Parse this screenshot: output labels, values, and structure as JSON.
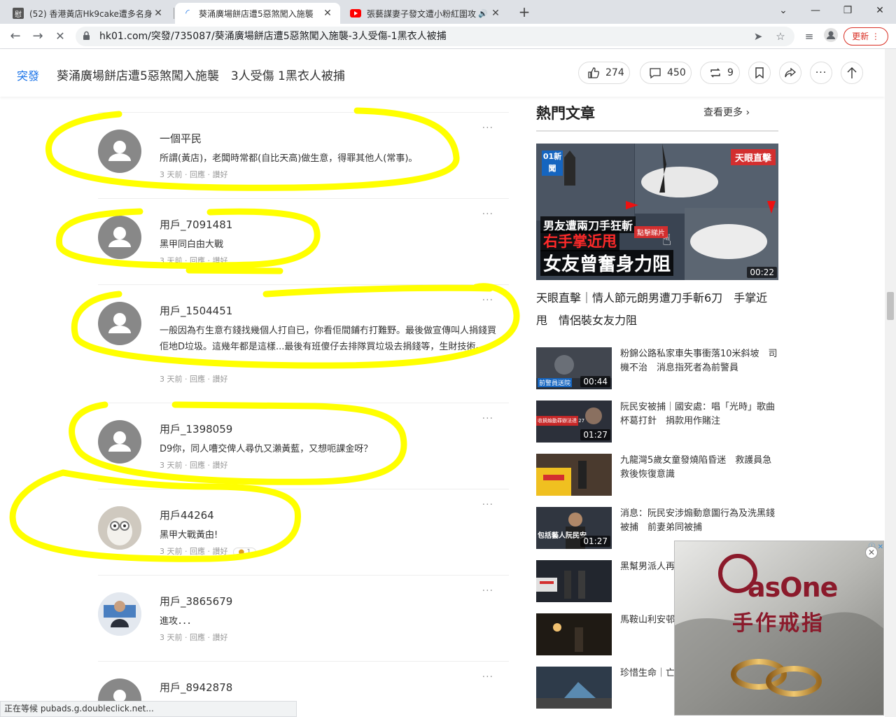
{
  "browser": {
    "tabs": [
      {
        "favicon": "hk9cake-favicon",
        "title": "(52) 香港黃店Hk9cake遭多名身份",
        "active": false
      },
      {
        "favicon": "hk01-favicon",
        "title": "葵涌廣場餅店遭5惡煞闖入施襲",
        "active": true
      },
      {
        "favicon": "youtube-favicon",
        "title": "張藝謀妻子發文遭小粉紅圍攻",
        "active": false
      }
    ],
    "url": "hk01.com/突發/735087/葵涌廣場餅店遭5惡煞闖入施襲-3人受傷-1黑衣人被捕",
    "update_label": "更新",
    "status_text": "正在等候 pubads.g.doubleclick.net..."
  },
  "header": {
    "section": "突發",
    "headline": "葵涌廣場餅店遭5惡煞闖入施襲　3人受傷 1黑衣人被捕",
    "likes": "274",
    "comments": "450",
    "shares": "9"
  },
  "comments": [
    {
      "name": "一個平民",
      "text": "所謂(黃店)，老闆時常都(自比天高)做生意，得罪其他人(常事)。",
      "meta": "3 天前 · 回應 · 讚好",
      "avatar": "default"
    },
    {
      "name": "用戶_7091481",
      "text": "黑甲同白甶大戰",
      "meta": "3 天前 · 回應 · 讚好",
      "avatar": "default"
    },
    {
      "name": "用戶_1504451",
      "text": "一般因為冇生意冇錢找幾個人打自已，你看佢間鋪冇打難野。最後做宣傳叫人捐錢買佢地D垃圾。這幾年都是這樣...最後有班傻仔去排隊買垃圾去捐錢等，生財技術。",
      "meta": "3 天前 · 回應 · 讚好",
      "avatar": "default"
    },
    {
      "name": "用戶_1398059",
      "text": "D9你，同人嘈交俾人尋仇又瀨黃藍，又想呃課金呀？",
      "meta": "3 天前 · 回應 · 讚好",
      "avatar": "default"
    },
    {
      "name": "用戶44264",
      "text": "黑甲大戰黃甶!",
      "meta": "3 天前 · 回應 · 讚好",
      "avatar": "owl",
      "reaction": "1"
    },
    {
      "name": "用戶_3865679",
      "text": "進攻．．．",
      "meta": "3 天前 · 回應 · 讚好",
      "avatar": "photo"
    },
    {
      "name": "用戶_8942878",
      "text": "",
      "meta": "",
      "avatar": "default"
    }
  ],
  "sidebar": {
    "title": "熱門文章",
    "see_more": "查看更多",
    "feature": {
      "badge": "天眼直擊",
      "logo": "01新聞",
      "caption1": "男友遭兩刀手狂斬",
      "caption2": "右手掌近甩",
      "caption3": "女友曾奮身力阻",
      "click_label": "點擊睇片",
      "duration": "00:22",
      "title": "天眼直擊｜情人節元朗男遭刀手斬6刀　手掌近甩　情侶裝女友力阻"
    },
    "items": [
      {
        "text": "粉錦公路私家車失事衝落10米斜坡　司機不治　消息指死者為前警員",
        "duration": "00:44",
        "thumb_color": "#3a3f48",
        "thumb_caption": "前警員送院"
      },
      {
        "text": "阮民安被捕｜國安處：唱「光時」歌曲　杯葛打針　捐款用作賭注",
        "duration": "01:27",
        "thumb_color": "#2a2e38",
        "thumb_caption": "收摘煽動罪辦法達 27"
      },
      {
        "text": "九龍灣5歲女童發燒陷昏迷　救護員急救後恢復意識",
        "duration": "",
        "thumb_color": "#5a4030",
        "thumb_caption": ""
      },
      {
        "text": "消息：阮民安涉煽動意圖行為及洗黑錢被捕　前妻弟同被捕",
        "duration": "01:27",
        "thumb_color": "#303640",
        "thumb_caption": "包括藝人阮民安"
      },
      {
        "text": "黑幫男派人再睇場「吹大咗」稱",
        "duration": "",
        "thumb_color": "#22262e",
        "thumb_caption": ""
      },
      {
        "text": "馬鞍山利安邨組調查　褒",
        "duration": "",
        "thumb_color": "#1f1a14",
        "thumb_caption": ""
      },
      {
        "text": "珍惜生命｜亡",
        "duration": "",
        "thumb_color": "#2e3b4a",
        "thumb_caption": ""
      }
    ]
  },
  "ad": {
    "brand": "asOne",
    "tagline": "手作戒指",
    "accent": "#8b1a2b"
  }
}
